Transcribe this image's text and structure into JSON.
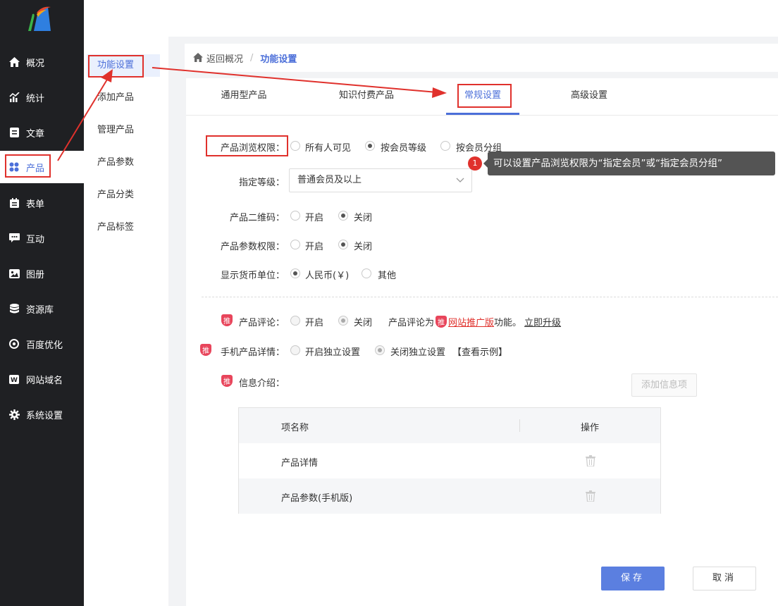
{
  "nav": {
    "items": [
      {
        "label": "概况",
        "icon": "home-icon"
      },
      {
        "label": "统计",
        "icon": "stats-icon"
      },
      {
        "label": "文章",
        "icon": "article-icon"
      },
      {
        "label": "产品",
        "icon": "product-icon"
      },
      {
        "label": "表单",
        "icon": "form-icon"
      },
      {
        "label": "互动",
        "icon": "chat-icon"
      },
      {
        "label": "图册",
        "icon": "album-icon"
      },
      {
        "label": "资源库",
        "icon": "database-icon"
      },
      {
        "label": "百度优化",
        "icon": "seo-icon"
      },
      {
        "label": "网站域名",
        "icon": "domain-icon"
      },
      {
        "label": "系统设置",
        "icon": "gear-icon"
      }
    ],
    "active_color": "#4c6fd9"
  },
  "subnav": {
    "items": [
      "功能设置",
      "添加产品",
      "管理产品",
      "产品参数",
      "产品分类",
      "产品标签"
    ]
  },
  "breadcrumb": {
    "back": "返回概况",
    "sep": "/",
    "current": "功能设置"
  },
  "tabs": [
    "通用型产品",
    "知识付费产品",
    "常规设置",
    "高级设置"
  ],
  "form": {
    "browse": {
      "label": "产品浏览权限：",
      "options": [
        "所有人可见",
        "按会员等级",
        "按会员分组"
      ],
      "selected": 1
    },
    "level": {
      "label": "指定等级：",
      "value": "普通会员及以上"
    },
    "qrcode": {
      "label": "产品二维码：",
      "options": [
        "开启",
        "关闭"
      ],
      "selected": 1
    },
    "param": {
      "label": "产品参数权限：",
      "options": [
        "开启",
        "关闭"
      ],
      "selected": 1
    },
    "currency": {
      "label": "显示货币单位：",
      "options": [
        "人民币(￥)",
        "其他"
      ],
      "selected": 0
    },
    "comment": {
      "label": "产品评论：",
      "options": [
        "开启",
        "关闭"
      ],
      "selected": 1,
      "note_prefix": "产品评论为",
      "note_link": "网站推广版",
      "note_suffix": "功能。",
      "upgrade": "立即升级"
    },
    "mobile": {
      "label": "手机产品详情：",
      "options": [
        "开启独立设置",
        "关闭独立设置"
      ],
      "selected": 1,
      "example": "【查看示例】"
    },
    "info": {
      "label": "信息介绍：",
      "add_button": "添加信息项"
    },
    "badge": "推"
  },
  "table": {
    "headers": [
      "项名称",
      "操作"
    ],
    "rows": [
      "产品详情",
      "产品参数(手机版)"
    ]
  },
  "tooltip": {
    "number": "1",
    "text": "可以设置产品浏览权限为“指定会员”或“指定会员分组”"
  },
  "buttons": {
    "save": "保存",
    "cancel": "取消"
  }
}
